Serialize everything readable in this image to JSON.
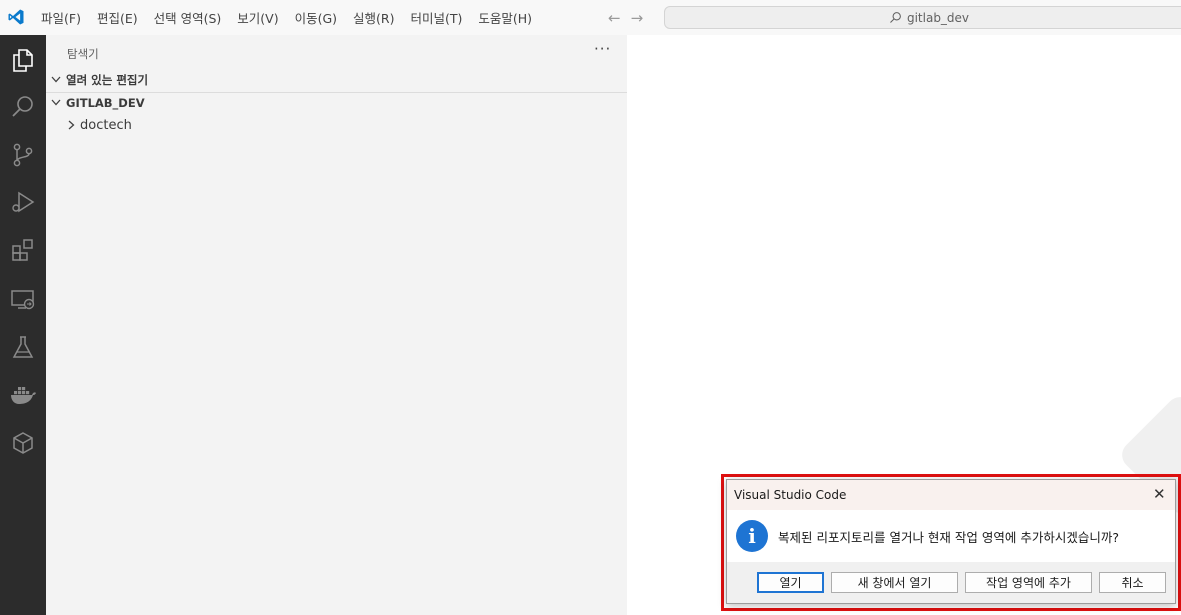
{
  "titlebar": {
    "menu": [
      "파일(F)",
      "편집(E)",
      "선택 영역(S)",
      "보기(V)",
      "이동(G)",
      "실행(R)",
      "터미널(T)",
      "도움말(H)"
    ],
    "back_arrow": "←",
    "forward_arrow": "→",
    "search_text": "gitlab_dev",
    "brand_color": "#0a7acc"
  },
  "activity_bar": {
    "icons": [
      "explorer-icon",
      "search-icon",
      "source-control-icon",
      "run-debug-icon",
      "extensions-icon",
      "remote-explorer-icon",
      "testing-icon",
      "docker-icon",
      "package-icon"
    ]
  },
  "sidebar": {
    "title": "탐색기",
    "more": "···",
    "open_editors": "열려 있는 편집기",
    "folder": "GITLAB_DEV",
    "items": [
      {
        "label": "doctech"
      }
    ]
  },
  "dialog": {
    "title": "Visual Studio Code",
    "close": "✕",
    "icon": "i",
    "message": "복제된 리포지토리를 열거나 현재 작업 영역에 추가하시겠습니까?",
    "buttons": {
      "open": "열기",
      "new_window": "새 창에서 열기",
      "add_workspace": "작업 영역에 추가",
      "cancel": "취소"
    },
    "highlight_color": "#e01010"
  }
}
